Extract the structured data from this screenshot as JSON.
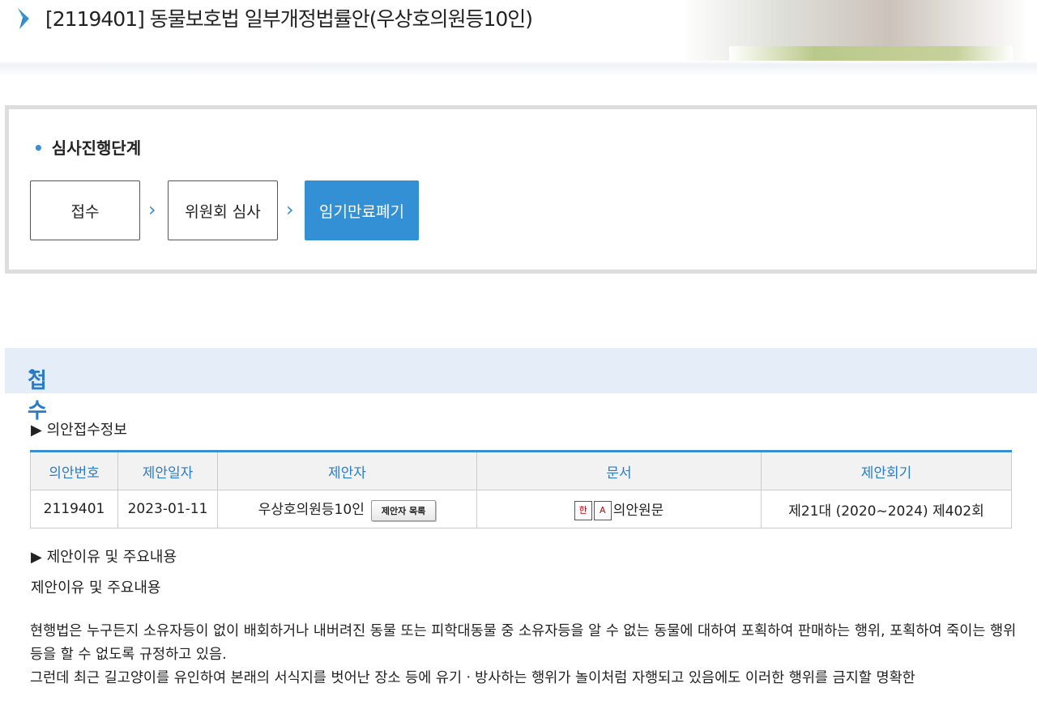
{
  "header": {
    "title": "[2119401] 동물보호법 일부개정법률안(우상호의원등10인)"
  },
  "stage": {
    "heading": "심사진행단계",
    "steps": [
      "접수",
      "위원회 심사",
      "임기만료폐기"
    ]
  },
  "section": {
    "title": "접수"
  },
  "receipt": {
    "label": "▶ 의안접수정보",
    "headers": [
      "의안번호",
      "제안일자",
      "제안자",
      "문서",
      "제안회기"
    ],
    "row": {
      "bill_no": "2119401",
      "date": "2023-01-11",
      "proposer": "우상호의원등10인",
      "proposer_button": "제안자 목록",
      "document": "의안원문",
      "session": "제21대 (2020~2024) 제402회"
    }
  },
  "reason": {
    "label": "▶ 제안이유 및 주요내용",
    "subtitle": "제안이유 및 주요내용",
    "p1": "현행법은 누구든지 소유자등이 없이 배회하거나 내버려진 동물 또는 피학대동물 중 소유자등을 알 수 없는 동물에 대하여 포획하여 판매하는 행위, 포획하여 죽이는 행위 등을 할 수 없도록 규정하고 있음.",
    "p2": "그런데 최근 길고양이를 유인하여 본래의 서식지를 벗어난 장소 등에 유기ㆍ방사하는 행위가 놀이처럼 자행되고 있음에도 이러한 행위를 금지할 명확한"
  }
}
